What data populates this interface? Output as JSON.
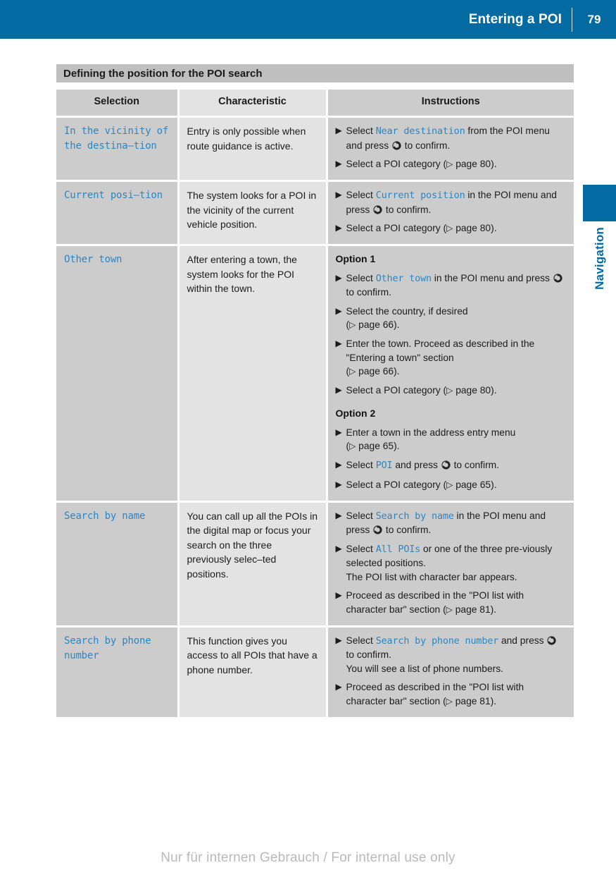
{
  "header": {
    "title": "Entering a POI",
    "page_number": "79"
  },
  "side_tab": {
    "label": "Navigation",
    "accent_color": "#036ba1"
  },
  "section": {
    "title": "Defining the position for the POI search"
  },
  "table": {
    "columns": [
      "Selection",
      "Characteristic",
      "Instructions"
    ],
    "rows": [
      {
        "selection": "In the vicinity of the destina–tion",
        "characteristic": "Entry is only possible when route guidance is active.",
        "steps": [
          {
            "parts": [
              {
                "t": "text",
                "v": "Select "
              },
              {
                "t": "term",
                "v": "Near destination"
              },
              {
                "t": "text",
                "v": " from the POI menu and press "
              },
              {
                "t": "knob",
                "v": "rotary-knob-icon"
              },
              {
                "t": "text",
                "v": " to confirm."
              }
            ]
          },
          {
            "parts": [
              {
                "t": "text",
                "v": "Select a POI category ("
              },
              {
                "t": "pageref",
                "v": "page 80"
              },
              {
                "t": "text",
                "v": ")."
              }
            ]
          }
        ]
      },
      {
        "selection": "Current posi–tion",
        "characteristic": "The system looks for a POI in the vicinity of the current vehicle position.",
        "steps": [
          {
            "parts": [
              {
                "t": "text",
                "v": "Select "
              },
              {
                "t": "term",
                "v": "Current position"
              },
              {
                "t": "text",
                "v": " in the POI menu and press "
              },
              {
                "t": "knob",
                "v": "rotary-knob-icon"
              },
              {
                "t": "text",
                "v": " to confirm."
              }
            ]
          },
          {
            "parts": [
              {
                "t": "text",
                "v": "Select a POI category ("
              },
              {
                "t": "pageref",
                "v": "page 80"
              },
              {
                "t": "text",
                "v": ")."
              }
            ]
          }
        ]
      },
      {
        "selection": "Other town",
        "characteristic": "After entering a town, the system looks for the POI within the town.",
        "option1_label": "Option 1",
        "option2_label": "Option 2",
        "steps": [
          {
            "parts": [
              {
                "t": "text",
                "v": "Select "
              },
              {
                "t": "term",
                "v": "Other town"
              },
              {
                "t": "text",
                "v": " in the POI menu and press "
              },
              {
                "t": "knob",
                "v": "rotary-knob-icon"
              },
              {
                "t": "text",
                "v": " to confirm."
              }
            ]
          },
          {
            "parts": [
              {
                "t": "text",
                "v": "Select the country, if desired"
              },
              {
                "t": "br",
                "v": ""
              },
              {
                "t": "text",
                "v": "("
              },
              {
                "t": "pageref",
                "v": "page 66"
              },
              {
                "t": "text",
                "v": ")."
              }
            ]
          },
          {
            "parts": [
              {
                "t": "text",
                "v": "Enter the town. Proceed as described in the \"Entering a town\" section"
              },
              {
                "t": "br",
                "v": ""
              },
              {
                "t": "text",
                "v": "("
              },
              {
                "t": "pageref",
                "v": "page 66"
              },
              {
                "t": "text",
                "v": ")."
              }
            ]
          },
          {
            "parts": [
              {
                "t": "text",
                "v": "Select a POI category ("
              },
              {
                "t": "pageref",
                "v": "page 80"
              },
              {
                "t": "text",
                "v": ")."
              }
            ]
          }
        ],
        "steps2": [
          {
            "parts": [
              {
                "t": "text",
                "v": "Enter a town in the address entry menu"
              },
              {
                "t": "br",
                "v": ""
              },
              {
                "t": "text",
                "v": "("
              },
              {
                "t": "pageref",
                "v": "page 65"
              },
              {
                "t": "text",
                "v": ")."
              }
            ]
          },
          {
            "parts": [
              {
                "t": "text",
                "v": "Select "
              },
              {
                "t": "term",
                "v": "POI"
              },
              {
                "t": "text",
                "v": " and press "
              },
              {
                "t": "knob",
                "v": "rotary-knob-icon"
              },
              {
                "t": "text",
                "v": " to confirm."
              }
            ]
          },
          {
            "parts": [
              {
                "t": "text",
                "v": "Select a POI category ("
              },
              {
                "t": "pageref",
                "v": "page 65"
              },
              {
                "t": "text",
                "v": ")."
              }
            ]
          }
        ]
      },
      {
        "selection": "Search by name",
        "characteristic": "You can call up all the POIs in the digital map or focus your search on the three previously selec–ted positions.",
        "steps": [
          {
            "parts": [
              {
                "t": "text",
                "v": "Select "
              },
              {
                "t": "term",
                "v": "Search by name"
              },
              {
                "t": "text",
                "v": " in the POI menu and press "
              },
              {
                "t": "knob",
                "v": "rotary-knob-icon"
              },
              {
                "t": "text",
                "v": " to confirm."
              }
            ]
          },
          {
            "parts": [
              {
                "t": "text",
                "v": "Select "
              },
              {
                "t": "term",
                "v": "All POIs"
              },
              {
                "t": "text",
                "v": " or one of the three pre-viously selected positions."
              },
              {
                "t": "br",
                "v": ""
              },
              {
                "t": "text",
                "v": "The POI list with character bar appears."
              }
            ]
          },
          {
            "parts": [
              {
                "t": "text",
                "v": "Proceed as described in the \"POI list with character bar\" section ("
              },
              {
                "t": "pageref",
                "v": "page 81"
              },
              {
                "t": "text",
                "v": ")."
              }
            ]
          }
        ]
      },
      {
        "selection": "Search by phone number",
        "characteristic": "This function gives you access to all POIs that have a phone number.",
        "steps": [
          {
            "parts": [
              {
                "t": "text",
                "v": "Select "
              },
              {
                "t": "term",
                "v": "Search by phone number"
              },
              {
                "t": "text",
                "v": " and press "
              },
              {
                "t": "knob",
                "v": "rotary-knob-icon"
              },
              {
                "t": "text",
                "v": " to confirm."
              },
              {
                "t": "br",
                "v": ""
              },
              {
                "t": "text",
                "v": "You will see a list of phone numbers."
              }
            ]
          },
          {
            "parts": [
              {
                "t": "text",
                "v": "Proceed as described in the \"POI list with character bar\" section ("
              },
              {
                "t": "pageref",
                "v": "page 81"
              },
              {
                "t": "text",
                "v": ")."
              }
            ]
          }
        ]
      }
    ]
  },
  "footer": {
    "watermark": "Nur für internen Gebrauch / For internal use only"
  },
  "glyphs": {
    "bullet": "▶",
    "page_arrow": "▷"
  }
}
